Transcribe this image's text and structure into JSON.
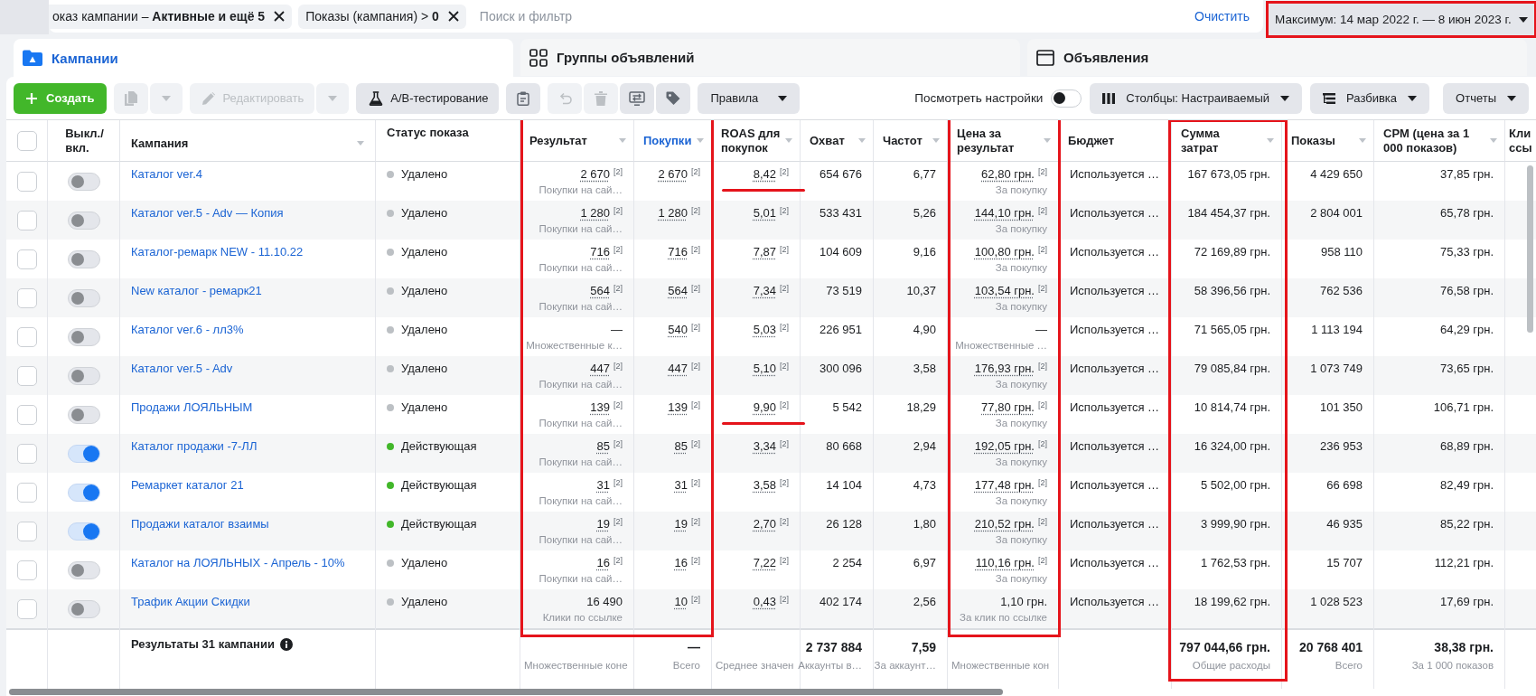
{
  "filter_bar": {
    "chips": [
      {
        "text": "оказ кампании – **Активные и ещё 5**"
      },
      {
        "text": "Показы (кампания) > **0**"
      }
    ],
    "search": {
      "placeholder": "Поиск и фильтр"
    },
    "clear_link": "Очистить",
    "date_range": {
      "label": "Максимум: 14 мар 2022 г. — 8 июн 2023 г.",
      "framed": true
    }
  },
  "tabs": [
    {
      "label": "Кампании",
      "selected": true
    },
    {
      "label": "Группы объявлений",
      "selected": false
    },
    {
      "label": "Объявления",
      "selected": false
    }
  ],
  "toolbar": {
    "groups": [
      [
        {
          "kind": "primary",
          "label": "Создать",
          "disabled": false
        }
      ],
      [
        {
          "kind": "icon",
          "disabled": true
        },
        {
          "kind": "caret",
          "disabled": true
        }
      ],
      [
        {
          "kind": "text",
          "label": "Редактировать",
          "disabled": true
        },
        {
          "kind": "caret",
          "disabled": true
        }
      ],
      [
        {
          "kind": "text",
          "label": "A/B-тестирование",
          "disabled": false
        }
      ],
      [
        {
          "kind": "icon",
          "disabled": false
        }
      ],
      [
        {
          "kind": "icon",
          "disabled": true
        },
        {
          "kind": "icon",
          "disabled": true
        },
        {
          "kind": "icon",
          "disabled": false
        },
        {
          "kind": "icon",
          "disabled": false
        }
      ],
      [
        {
          "kind": "menu",
          "label": "Правила",
          "disabled": false
        }
      ]
    ],
    "view_settings": {
      "label": "Посмотреть настройки",
      "on": false
    },
    "menus": [
      {
        "label": "Столбцы: Настраиваемый"
      },
      {
        "label": "Разбивка"
      },
      {
        "label": "Отчеты"
      }
    ]
  },
  "table": {
    "columns": [
      {
        "kind": "checkbox",
        "selected": false
      },
      {
        "kind": "toggle",
        "label": "Выкл./\nвкл.",
        "sortable": false,
        "sorted": false
      },
      {
        "kind": "name",
        "label": "Кампания",
        "sortable": true,
        "sorted": false
      },
      {
        "kind": "status",
        "label": "Статус показа",
        "sortable": false,
        "sorted": false
      },
      {
        "kind": "number",
        "label": "Результат",
        "sortable": true,
        "sorted": false,
        "framed": true,
        "frame_reaches_totals": false
      },
      {
        "kind": "number",
        "label": "Покупки",
        "sortable": true,
        "sorted": true,
        "framed": true,
        "frame_reaches_totals": false
      },
      {
        "kind": "number",
        "label": "ROAS для\nпокупок",
        "sortable": true,
        "sorted": false
      },
      {
        "kind": "number",
        "label": "Охват",
        "sortable": true,
        "sorted": false
      },
      {
        "kind": "number",
        "label": "Частот",
        "sortable": true,
        "sorted": false
      },
      {
        "kind": "number",
        "label": "Цена за\nрезультат",
        "sortable": true,
        "sorted": false,
        "framed": true,
        "frame_reaches_totals": false
      },
      {
        "kind": "text",
        "label": "Бюджет",
        "sortable": false,
        "sorted": false
      },
      {
        "kind": "number",
        "label": "Сумма\nзатрат",
        "sortable": true,
        "sorted": false,
        "framed": true,
        "frame_reaches_totals": true
      },
      {
        "kind": "number",
        "label": "Показы",
        "sortable": true,
        "sorted": false
      },
      {
        "kind": "number",
        "label": "CPM (цена за 1\n000 показов)",
        "sortable": true,
        "sorted": false
      },
      {
        "kind": "number",
        "label": "Кли\nссы",
        "sortable": false,
        "sorted": false
      }
    ],
    "rows": [
      {
        "selected": false,
        "cells": [
          "",
          {
            "on": false
          },
          "Каталог ver.4",
          {
            "label": "Удалено",
            "color": "#bcc0c4"
          },
          {
            "value": "2 670$^{[2]}$",
            "dotted": true,
            "caption": "Покупки на сай…"
          },
          {
            "value": "2 670$^{[2]}$",
            "dotted": true
          },
          {
            "value": "8,42$^{[2]}$",
            "dotted": true,
            "marked": true
          },
          "654 676",
          "6,77",
          {
            "value": "62,80 грн.$^{[2]}$",
            "dotted": true,
            "caption": "За покупку"
          },
          "Используется …",
          "167 673,05 грн.",
          "4 429 650",
          "37,85 грн."
        ]
      },
      {
        "selected": false,
        "cells": [
          "",
          {
            "on": false
          },
          "Каталог ver.5 - Adv — Копия",
          {
            "label": "Удалено",
            "color": "#bcc0c4"
          },
          {
            "value": "1 280$^{[2]}$",
            "dotted": true,
            "caption": "Покупки на сай…"
          },
          {
            "value": "1 280$^{[2]}$",
            "dotted": true
          },
          {
            "value": "5,01$^{[2]}$",
            "dotted": true
          },
          "533 431",
          "5,26",
          {
            "value": "144,10 грн.$^{[2]}$",
            "dotted": true,
            "caption": "За покупку"
          },
          "Используется …",
          "184 454,37 грн.",
          "2 804 001",
          "65,78 грн."
        ]
      },
      {
        "selected": false,
        "cells": [
          "",
          {
            "on": false
          },
          "Каталог-ремарк NEW - 11.10.22",
          {
            "label": "Удалено",
            "color": "#bcc0c4"
          },
          {
            "value": "716$^{[2]}$",
            "dotted": true,
            "caption": "Покупки на сай…"
          },
          {
            "value": "716$^{[2]}$",
            "dotted": true
          },
          {
            "value": "7,87$^{[2]}$",
            "dotted": true
          },
          "104 609",
          "9,16",
          {
            "value": "100,80 грн.$^{[2]}$",
            "dotted": true,
            "caption": "За покупку"
          },
          "Используется …",
          "72 169,89 грн.",
          "958 110",
          "75,33 грн."
        ]
      },
      {
        "selected": false,
        "cells": [
          "",
          {
            "on": false
          },
          "New каталог - ремарк21",
          {
            "label": "Удалено",
            "color": "#bcc0c4"
          },
          {
            "value": "564$^{[2]}$",
            "dotted": true,
            "caption": "Покупки на сай…"
          },
          {
            "value": "564$^{[2]}$",
            "dotted": true
          },
          {
            "value": "7,34$^{[2]}$",
            "dotted": true
          },
          "73 519",
          "10,37",
          {
            "value": "103,54 грн.$^{[2]}$",
            "dotted": true,
            "caption": "За покупку"
          },
          "Используется …",
          "58 396,56 грн.",
          "762 536",
          "76,58 грн."
        ]
      },
      {
        "selected": false,
        "cells": [
          "",
          {
            "on": false
          },
          "Каталог ver.6 - лл3%",
          {
            "label": "Удалено",
            "color": "#bcc0c4"
          },
          {
            "value": "—",
            "dotted": false,
            "caption": "Множественные к…"
          },
          {
            "value": "540$^{[2]}$",
            "dotted": true
          },
          {
            "value": "5,03$^{[2]}$",
            "dotted": true
          },
          "226 951",
          "4,90",
          {
            "value": "—",
            "dotted": false,
            "caption": "Множественные …"
          },
          "Используется …",
          "71 565,05 грн.",
          "1 113 194",
          "64,29 грн."
        ]
      },
      {
        "selected": false,
        "cells": [
          "",
          {
            "on": false
          },
          "Каталог ver.5 - Adv",
          {
            "label": "Удалено",
            "color": "#bcc0c4"
          },
          {
            "value": "447$^{[2]}$",
            "dotted": true,
            "caption": "Покупки на сай…"
          },
          {
            "value": "447$^{[2]}$",
            "dotted": true
          },
          {
            "value": "5,10$^{[2]}$",
            "dotted": true
          },
          "300 096",
          "3,58",
          {
            "value": "176,93 грн.$^{[2]}$",
            "dotted": true,
            "caption": "За покупку"
          },
          "Используется …",
          "79 085,84 грн.",
          "1 073 749",
          "73,65 грн."
        ]
      },
      {
        "selected": false,
        "cells": [
          "",
          {
            "on": false
          },
          "Продажи ЛОЯЛЬНЫМ",
          {
            "label": "Удалено",
            "color": "#bcc0c4"
          },
          {
            "value": "139$^{[2]}$",
            "dotted": true,
            "caption": "Покупки на сай…"
          },
          {
            "value": "139$^{[2]}$",
            "dotted": true
          },
          {
            "value": "9,90$^{[2]}$",
            "dotted": true,
            "marked": true
          },
          "5 542",
          "18,29",
          {
            "value": "77,80 грн.$^{[2]}$",
            "dotted": true,
            "caption": "За покупку"
          },
          "Используется …",
          "10 814,74 грн.",
          "101 350",
          "106,71 грн."
        ]
      },
      {
        "selected": false,
        "cells": [
          "",
          {
            "on": true
          },
          "Каталог продажи -7-ЛЛ",
          {
            "label": "Действующая",
            "color": "#42b72a"
          },
          {
            "value": "85$^{[2]}$",
            "dotted": true,
            "caption": "Покупки на сай…"
          },
          {
            "value": "85$^{[2]}$",
            "dotted": true
          },
          {
            "value": "3,34$^{[2]}$",
            "dotted": true
          },
          "80 668",
          "2,94",
          {
            "value": "192,05 грн.$^{[2]}$",
            "dotted": true,
            "caption": "За покупку"
          },
          "Используется …",
          "16 324,00 грн.",
          "236 953",
          "68,89 грн."
        ]
      },
      {
        "selected": false,
        "cells": [
          "",
          {
            "on": true
          },
          "Ремаркет каталог 21",
          {
            "label": "Действующая",
            "color": "#42b72a"
          },
          {
            "value": "31$^{[2]}$",
            "dotted": true,
            "caption": "Покупки на сай…"
          },
          {
            "value": "31$^{[2]}$",
            "dotted": true
          },
          {
            "value": "3,58$^{[2]}$",
            "dotted": true
          },
          "14 104",
          "4,73",
          {
            "value": "177,48 грн.$^{[2]}$",
            "dotted": true,
            "caption": "За покупку"
          },
          "Используется …",
          "5 502,00 грн.",
          "66 698",
          "82,49 грн."
        ]
      },
      {
        "selected": false,
        "cells": [
          "",
          {
            "on": true
          },
          "Продажи каталог взаимы",
          {
            "label": "Действующая",
            "color": "#42b72a"
          },
          {
            "value": "19$^{[2]}$",
            "dotted": true,
            "caption": "Покупки на сай…"
          },
          {
            "value": "19$^{[2]}$",
            "dotted": true
          },
          {
            "value": "2,70$^{[2]}$",
            "dotted": true
          },
          "26 128",
          "1,80",
          {
            "value": "210,52 грн.$^{[2]}$",
            "dotted": true,
            "caption": "За покупку"
          },
          "Используется …",
          "3 999,90 грн.",
          "46 935",
          "85,22 грн."
        ]
      },
      {
        "selected": false,
        "cells": [
          "",
          {
            "on": false
          },
          "Каталог на ЛОЯЛЬНЫХ - Апрель - 10%",
          {
            "label": "Удалено",
            "color": "#bcc0c4"
          },
          {
            "value": "16$^{[2]}$",
            "dotted": true,
            "caption": "Покупки на сай…"
          },
          {
            "value": "16$^{[2]}$",
            "dotted": true
          },
          {
            "value": "7,22$^{[2]}$",
            "dotted": true
          },
          "2 254",
          "6,97",
          {
            "value": "110,16 грн.$^{[2]}$",
            "dotted": true,
            "caption": "За покупку"
          },
          "Используется …",
          "1 762,53 грн.",
          "15 707",
          "112,21 грн."
        ]
      },
      {
        "selected": false,
        "cells": [
          "",
          {
            "on": false
          },
          "Трафик Акции Скидки",
          {
            "label": "Удалено",
            "color": "#bcc0c4"
          },
          {
            "value": "16 490",
            "dotted": false,
            "caption": "Клики по ссылке"
          },
          {
            "value": "10$^{[2]}$",
            "dotted": true
          },
          {
            "value": "0,43$^{[2]}$",
            "dotted": true
          },
          "402 174",
          "2,56",
          {
            "value": "1,10 грн.",
            "dotted": false,
            "caption": "За клик по ссылке"
          },
          "Используется …",
          "18 199,62 грн.",
          "1 028 523",
          "17,69 грн."
        ]
      }
    ],
    "summary": {
      "cells": [
        "",
        "",
        "Результаты 31 кампании",
        "",
        {
          "caption": "Множественные коне"
        },
        {
          "value": "—",
          "caption": "Всего"
        },
        {
          "caption": "Среднее значен"
        },
        {
          "value": "2 737 884",
          "caption": "Аккаунты в…"
        },
        {
          "value": "7,59",
          "caption": "За аккаунт…"
        },
        {
          "caption": "Множественные кон"
        },
        "",
        {
          "value": "797 044,66 грн.",
          "caption": "Общие расходы"
        },
        {
          "value": "20 768 401",
          "caption": "Всего"
        },
        {
          "value": "38,38 грн.",
          "caption": "За 1 000 показов"
        }
      ]
    }
  }
}
